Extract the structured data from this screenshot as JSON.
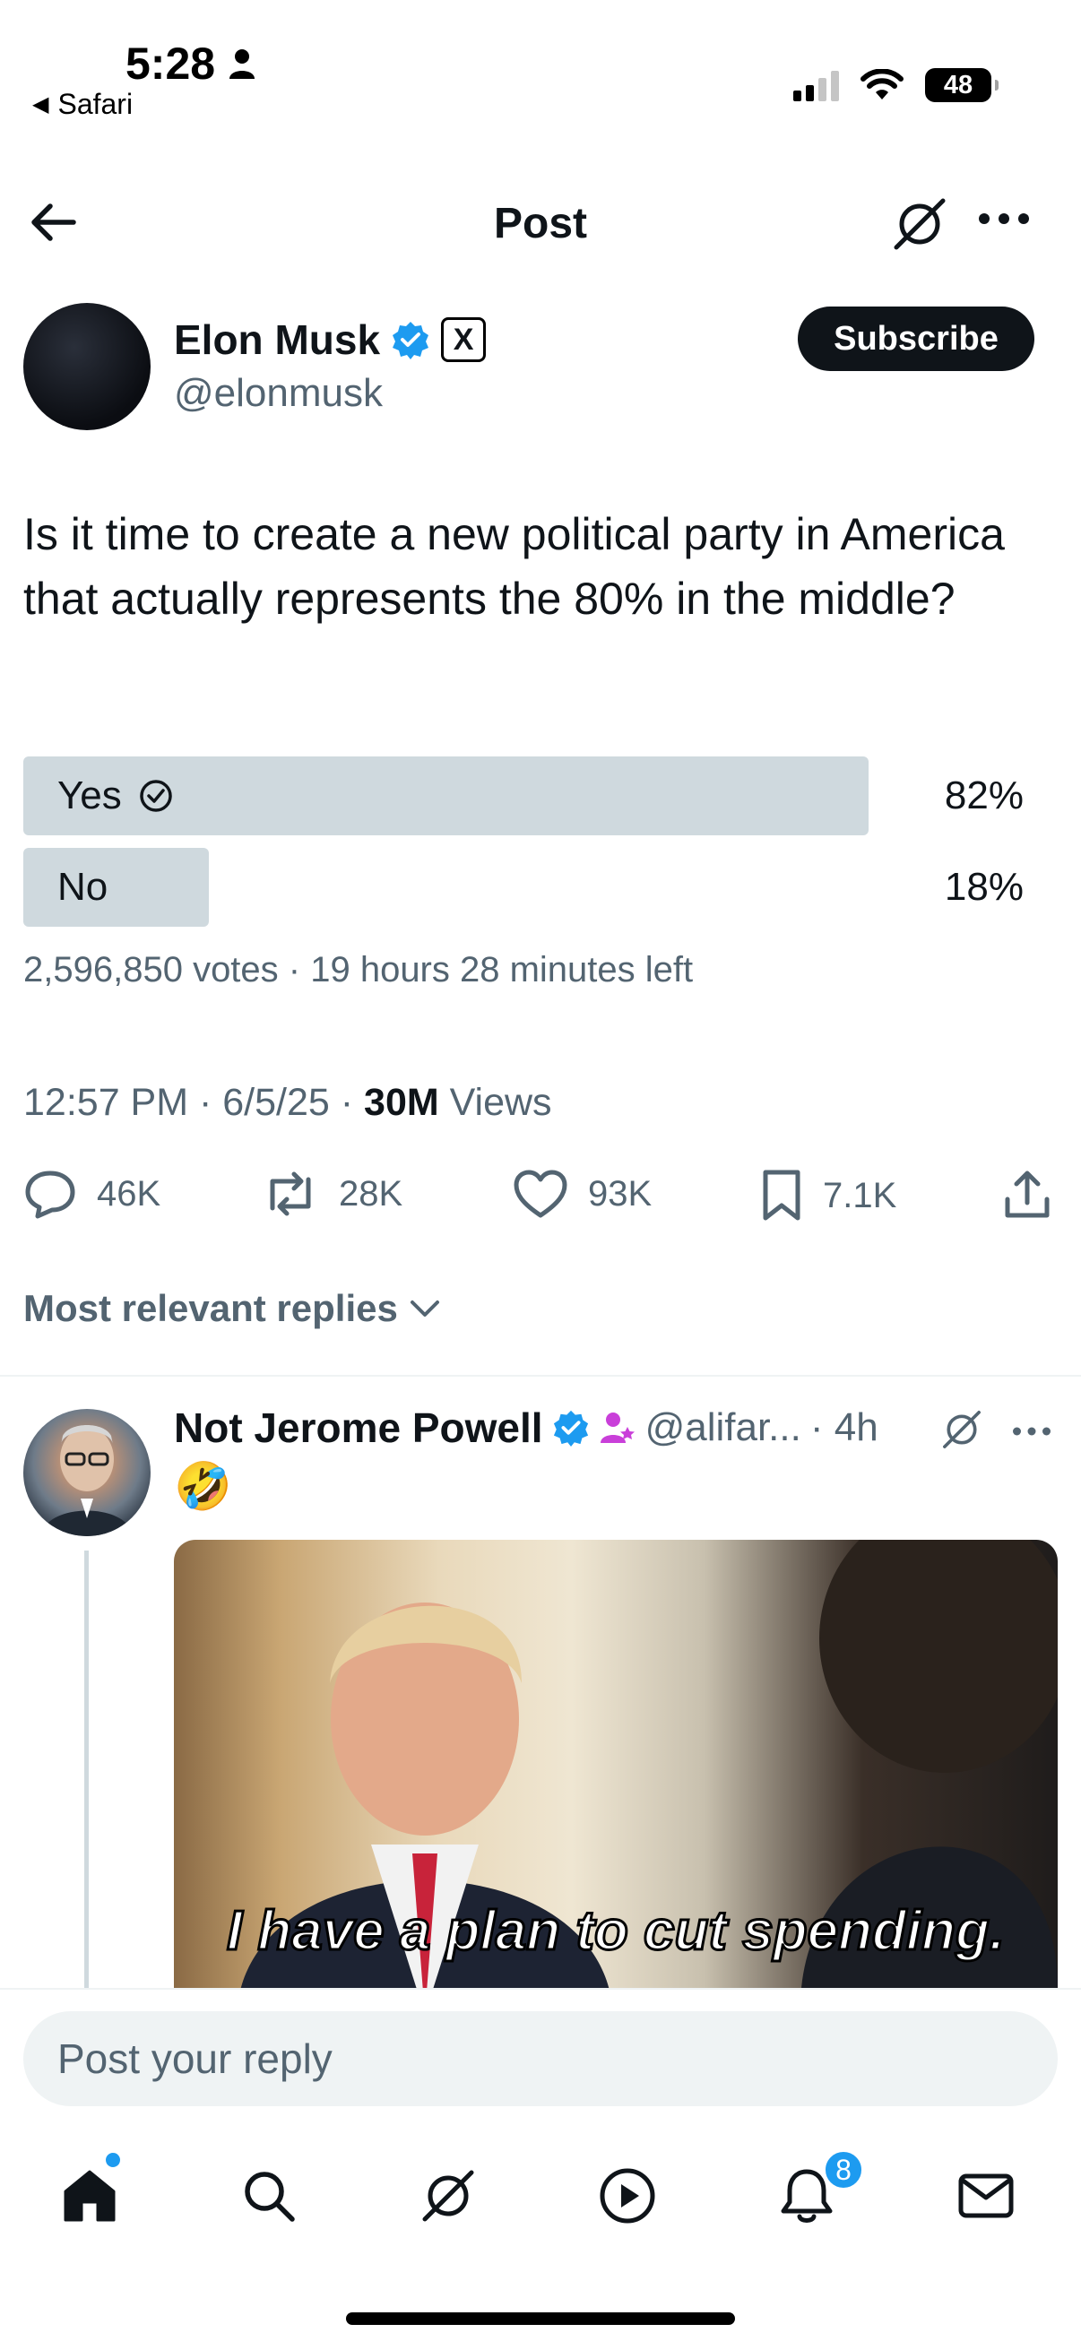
{
  "status_bar": {
    "time": "5:28",
    "back_app": "Safari",
    "battery": "48"
  },
  "header": {
    "title": "Post"
  },
  "author": {
    "name": "Elon Musk",
    "handle": "@elonmusk",
    "subscribe_label": "Subscribe",
    "x_badge": "X"
  },
  "post": {
    "text": "Is it time to create a new political party in America that actually represents the 80% in the middle?",
    "poll": {
      "options": [
        {
          "label": "Yes",
          "percent_label": "82%",
          "percent": 82,
          "selected": true
        },
        {
          "label": "No",
          "percent_label": "18%",
          "percent": 18,
          "selected": false
        }
      ],
      "meta": "2,596,850 votes · 19 hours 28 minutes left"
    },
    "time": "12:57 PM · 6/5/25 · ",
    "views_count": "30M",
    "views_label": " Views",
    "actions": {
      "replies": "46K",
      "reposts": "28K",
      "likes": "93K",
      "bookmarks": "7.1K"
    }
  },
  "replies_sort": "Most relevant replies",
  "reply": {
    "name": "Not Jerome Powell",
    "handle": "@alifar...",
    "time": "· 4h",
    "emoji": "🤣",
    "media_caption": "I have a plan to cut spending."
  },
  "composer": {
    "placeholder": "Post your reply"
  },
  "tab_bar": {
    "notifications_count": "8"
  },
  "colors": {
    "accent": "#1d9bf0",
    "text": "#0f1419",
    "secondary": "#536471",
    "poll_bar": "#cfd9de"
  }
}
